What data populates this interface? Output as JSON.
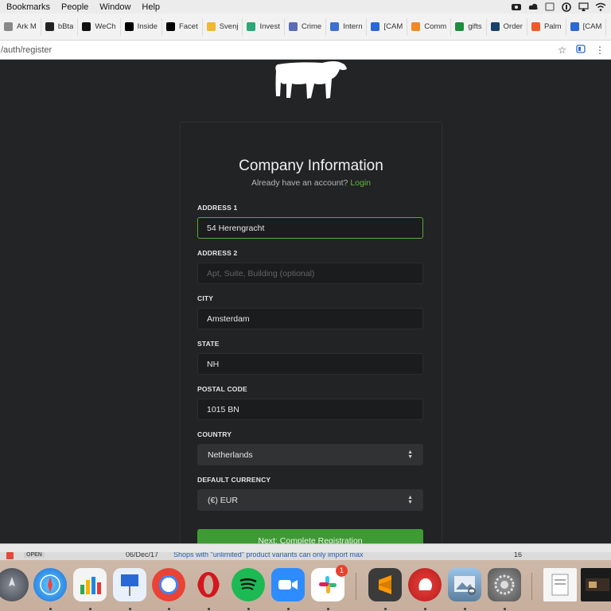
{
  "menubar": {
    "items": [
      "Bookmarks",
      "People",
      "Window",
      "Help"
    ]
  },
  "bookmarks": [
    {
      "label": "Ark M",
      "color": "#888888"
    },
    {
      "label": "bBta",
      "color": "#222222"
    },
    {
      "label": "WeCh",
      "color": "#111111"
    },
    {
      "label": "Inside",
      "color": "#000000"
    },
    {
      "label": "Facet",
      "color": "#000000"
    },
    {
      "label": "Svenj",
      "color": "#f2b731"
    },
    {
      "label": "Invest",
      "color": "#2aa876"
    },
    {
      "label": "Crime",
      "color": "#5a6bb8"
    },
    {
      "label": "Intern",
      "color": "#3b6fd1"
    },
    {
      "label": "[CAM",
      "color": "#2a68d6"
    },
    {
      "label": "Comm",
      "color": "#f08a24"
    },
    {
      "label": "gifts",
      "color": "#1e8e3e"
    },
    {
      "label": "Order",
      "color": "#16416b"
    },
    {
      "label": "Palm",
      "color": "#f05a28"
    },
    {
      "label": "[CAM",
      "color": "#2a68d6"
    }
  ],
  "address": {
    "url": "/auth/register"
  },
  "form": {
    "title": "Company Information",
    "subtitle_prefix": "Already have an account?",
    "login_link": "Login",
    "fields": {
      "address1_label": "ADDRESS 1",
      "address1_value": "54 Herengracht",
      "address2_label": "ADDRESS 2",
      "address2_placeholder": "Apt, Suite, Building (optional)",
      "city_label": "CITY",
      "city_value": "Amsterdam",
      "state_label": "STATE",
      "state_value": "NH",
      "postal_label": "POSTAL CODE",
      "postal_value": "1015 BN",
      "country_label": "COUNTRY",
      "country_value": "Netherlands",
      "currency_label": "DEFAULT CURRENCY",
      "currency_value": "(€) EUR"
    },
    "next_button": "Next: Complete Registration"
  },
  "notification": {
    "open_label": "OPEN",
    "date": "06/Dec/17",
    "link_text": "Shops with \"unlimited\" product variants can only import max",
    "number": "16"
  },
  "dock": {
    "slack_badge": "1"
  },
  "colors": {
    "accent_green": "#3e9a33",
    "link_green": "#5fb945",
    "page_bg": "#232425"
  }
}
